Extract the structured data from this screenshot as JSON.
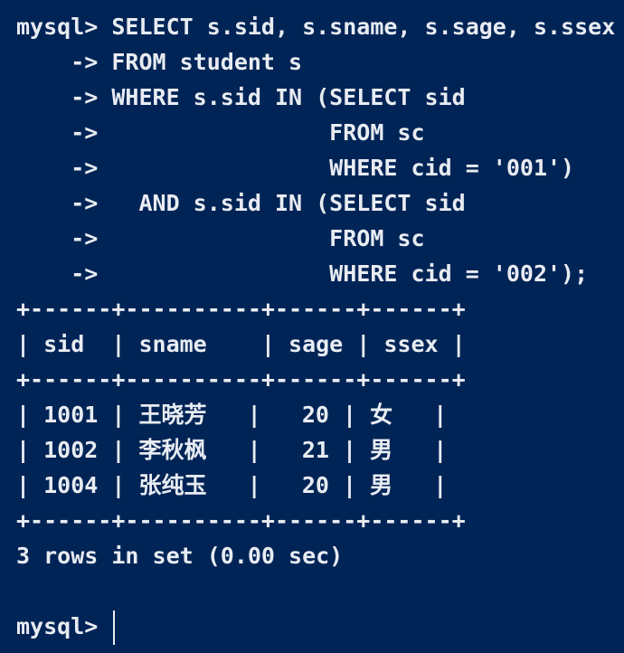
{
  "terminal": {
    "lines": [
      "mysql> SELECT s.sid, s.sname, s.sage, s.ssex",
      "    -> FROM student s",
      "    -> WHERE s.sid IN (SELECT sid",
      "    ->                 FROM sc",
      "    ->                 WHERE cid = '001')",
      "    ->   AND s.sid IN (SELECT sid",
      "    ->                 FROM sc",
      "    ->                 WHERE cid = '002');",
      "+------+----------+------+------+",
      "| sid  | sname    | sage | ssex |",
      "+------+----------+------+------+",
      "| 1001 | 王晓芳   |   20 | 女   |",
      "| 1002 | 李秋枫   |   21 | 男   |",
      "| 1004 | 张纯玉   |   20 | 男   |",
      "+------+----------+------+------+",
      "3 rows in set (0.00 sec)",
      "",
      "mysql> "
    ]
  }
}
